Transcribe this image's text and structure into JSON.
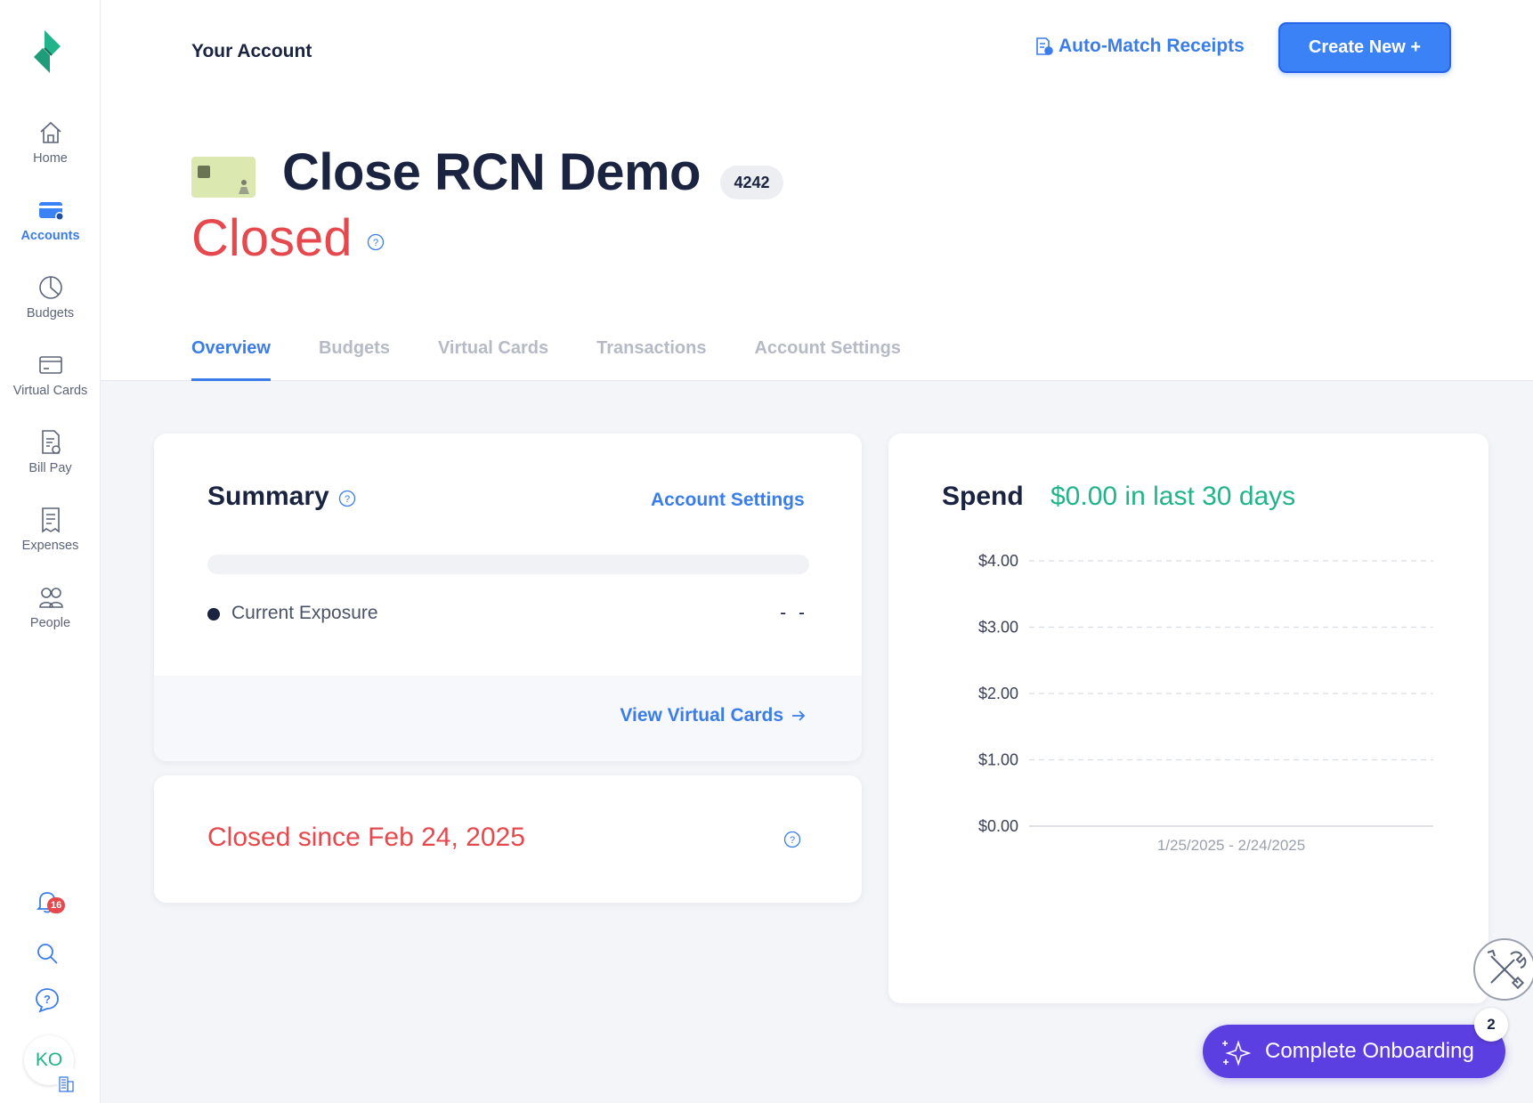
{
  "sidebar": {
    "items": [
      {
        "label": "Home",
        "icon": "home-icon"
      },
      {
        "label": "Accounts",
        "icon": "card-icon"
      },
      {
        "label": "Budgets",
        "icon": "pie-chart-icon"
      },
      {
        "label": "Virtual Cards",
        "icon": "virtual-card-icon"
      },
      {
        "label": "Bill Pay",
        "icon": "bill-icon"
      },
      {
        "label": "Expenses",
        "icon": "receipt-icon"
      },
      {
        "label": "People",
        "icon": "people-icon"
      }
    ],
    "active": "Accounts",
    "notifications_count": "16",
    "avatar_initials": "KO"
  },
  "header": {
    "breadcrumb": "Your Account",
    "auto_match_label": "Auto-Match Receipts",
    "create_label": "Create New +",
    "account_name": "Close RCN Demo",
    "last4": "4242",
    "status": "Closed",
    "tabs": [
      "Overview",
      "Budgets",
      "Virtual Cards",
      "Transactions",
      "Account Settings"
    ],
    "active_tab": "Overview"
  },
  "summary": {
    "title": "Summary",
    "settings_link": "Account Settings",
    "exposure_label": "Current Exposure",
    "exposure_value": "- -",
    "exposure_fraction": 0,
    "view_virtual_cards": "View Virtual Cards"
  },
  "closed_card": {
    "text": "Closed since Feb 24, 2025"
  },
  "spend": {
    "title": "Spend",
    "amount": "$0.00 in last 30 days"
  },
  "chart_data": {
    "type": "line",
    "x": [
      "1/25/2025 - 2/24/2025"
    ],
    "series": [
      {
        "values": [
          0
        ]
      }
    ],
    "ylim": [
      0,
      4
    ],
    "y_ticks": [
      "$0.00",
      "$1.00",
      "$2.00",
      "$3.00",
      "$4.00"
    ],
    "grid": true,
    "colors": {
      "grid": "#d9dde5",
      "baseline": "#c9cdd6"
    }
  },
  "onboarding": {
    "label": "Complete Onboarding",
    "count": "2"
  },
  "colors": {
    "accent": "#3b7de8",
    "danger": "#e5484d",
    "success": "#21b38a",
    "onboarding": "#5b3fe0",
    "navy": "#1a2340"
  }
}
